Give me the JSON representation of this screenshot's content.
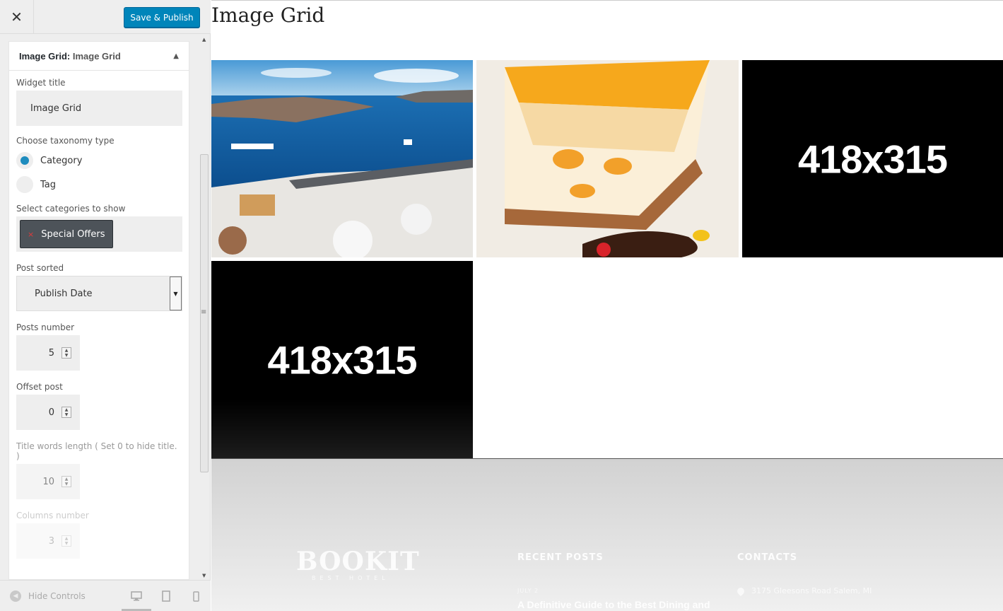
{
  "header": {
    "close_icon": "close-icon",
    "publish_label": "Save & Publish",
    "publish_color": "#0085ba"
  },
  "widget": {
    "title_prefix": "Image Grid:",
    "title_name": "Image Grid",
    "collapse_icon": "triangle-up-icon"
  },
  "form": {
    "widget_title_label": "Widget title",
    "widget_title_value": "Image Grid",
    "taxonomy_label": "Choose taxonomy type",
    "taxonomy_options": [
      {
        "label": "Category",
        "checked": true
      },
      {
        "label": "Tag",
        "checked": false
      }
    ],
    "categories_label": "Select categories to show",
    "categories_selected": [
      {
        "remove": "×",
        "label": "Special Offers"
      }
    ],
    "post_sorted_label": "Post sorted",
    "post_sorted_value": "Publish Date",
    "posts_number_label": "Posts number",
    "posts_number_value": "5",
    "offset_post_label": "Offset post",
    "offset_post_value": "0",
    "title_words_label": "Title words length ( Set 0 to hide title. )",
    "title_words_value": "10",
    "columns_label": "Columns number",
    "columns_value": "3"
  },
  "footer_controls": {
    "hide_controls_label": "Hide Controls",
    "devices": [
      "desktop-icon",
      "tablet-icon",
      "mobile-icon"
    ]
  },
  "preview": {
    "title": "Image Grid",
    "tiles": [
      {
        "kind": "photo",
        "subject": "santorini-sea-view"
      },
      {
        "kind": "photo",
        "subject": "orange-cheesecake"
      },
      {
        "kind": "placeholder",
        "text": "418x315"
      },
      {
        "kind": "placeholder",
        "text": "418x315"
      }
    ],
    "footer": {
      "brand": "BOOKIT",
      "brand_sub": "BEST HOTEL",
      "recent_posts_heading": "RECENT POSTS",
      "contacts_heading": "CONTACTS",
      "post_date": "JULY 2",
      "post_title": "A Definitive Guide to the Best Dining and",
      "contact_address": "3175 Gleesons Road Salem, MI"
    }
  }
}
